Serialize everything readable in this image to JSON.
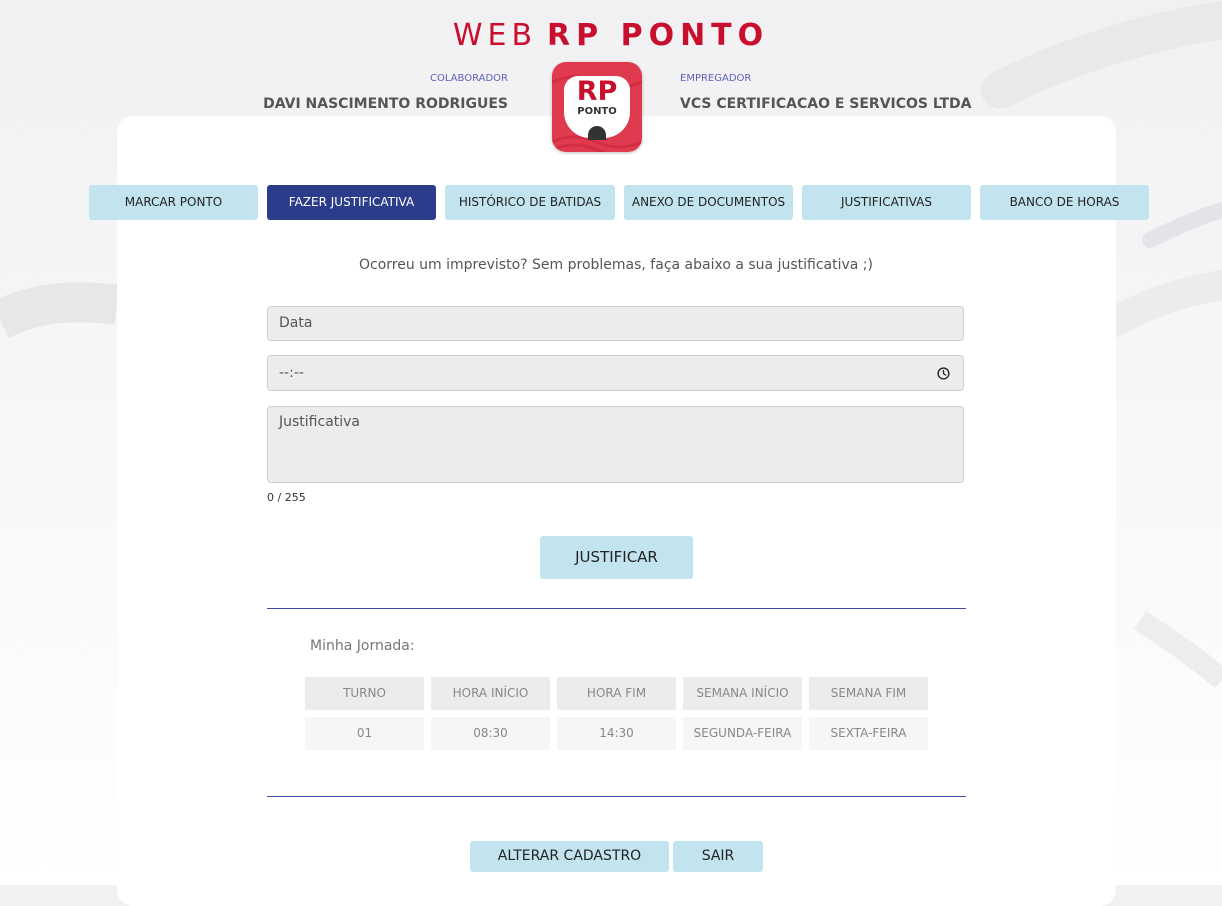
{
  "header": {
    "title_light": "WEB",
    "title_bold": "RP PONTO",
    "collaborator_label": "COLABORADOR",
    "collaborator_name": "DAVI NASCIMENTO RODRIGUES",
    "employer_label": "EMPREGADOR",
    "employer_name": "VCS CERTIFICACAO E SERVICOS LTDA",
    "logo_text_main": "RP",
    "logo_text_sub": "PONTO"
  },
  "tabs": [
    {
      "label": "MARCAR PONTO",
      "active": false
    },
    {
      "label": "FAZER JUSTIFICATIVA",
      "active": true
    },
    {
      "label": "HISTÓRICO DE BATIDAS",
      "active": false
    },
    {
      "label": "ANEXO DE DOCUMENTOS",
      "active": false
    },
    {
      "label": "JUSTIFICATIVAS",
      "active": false
    },
    {
      "label": "BANCO DE HORAS",
      "active": false
    }
  ],
  "form": {
    "subtitle": "Ocorreu um imprevisto? Sem problemas, faça abaixo a sua justificativa ;)",
    "date_placeholder": "Data",
    "time_value": "--:--",
    "justification_placeholder": "Justificativa",
    "char_counter": "0 / 255",
    "submit_label": "JUSTIFICAR"
  },
  "jornada": {
    "label": "Minha Jornada:",
    "headers": [
      "TURNO",
      "HORA INÍCIO",
      "HORA FIM",
      "SEMANA INÍCIO",
      "SEMANA FIM"
    ],
    "rows": [
      [
        "01",
        "08:30",
        "14:30",
        "SEGUNDA-FEIRA",
        "SEXTA-FEIRA"
      ]
    ]
  },
  "footer": {
    "edit_label": "ALTERAR CADASTRO",
    "logout_label": "SAIR"
  },
  "colors": {
    "brand_red": "#c8102e",
    "active_tab": "#2b3d8a",
    "button_bg": "#c2e4ee",
    "divider": "#3a4ea3"
  }
}
